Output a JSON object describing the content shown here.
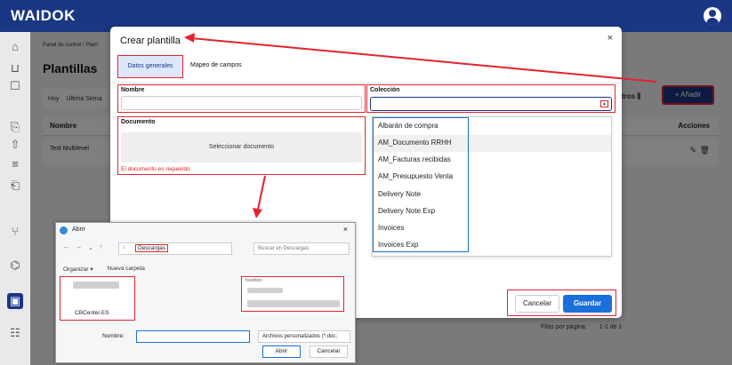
{
  "app": {
    "brand": "WAIDOK"
  },
  "background": {
    "breadcrumb": "Panel de control  /  Plant",
    "page_title": "Plantillas",
    "filters": [
      "Hoy",
      "Última Sema"
    ],
    "filters_button": "tros ⫼",
    "add_button": "+ Añadir",
    "table": {
      "col_name": "Nombre",
      "col_actions": "Acciones",
      "row_name": "Test Multilevel"
    },
    "pager": {
      "rows_label": "Filas por página:",
      "range": "1-1 de 1"
    }
  },
  "modal": {
    "title": "Crear plantilla",
    "close": "×",
    "tabs": [
      "Datos generales",
      "Mapeo de campos"
    ],
    "nombre_label": "Nombre",
    "coleccion_label": "Colección",
    "documento_label": "Documento",
    "select_doc": "Seleccionar documento",
    "doc_error": "El documento es requerido",
    "collection_options": [
      "Albarán de compra",
      "AM_Documento RRHH",
      "AM_Facturas recibidas",
      "AM_Presupuesto Venta",
      "Delivery Note",
      "Delivery Note Exp",
      "Invoices",
      "Invoices Exp"
    ],
    "cancel": "Cancelar",
    "save": "Guardar"
  },
  "file_dialog": {
    "title": "Abrir",
    "close": "×",
    "path": "Descargas",
    "search_placeholder": "Buscar en Descargas",
    "toolbar_organize": "Organizar ▾",
    "toolbar_new_folder": "Nueva carpeta",
    "left_item": "CBCenter.ES",
    "right_header": "hoottoo:",
    "name_label": "Nombre:",
    "file_type": "Archivos personalizados (*.doc;",
    "open": "Abrir",
    "cancel": "Cancelar"
  },
  "colors": {
    "primary": "#1a3784",
    "accent_blue": "#1a6fdb",
    "highlight_red": "#e3232e"
  }
}
